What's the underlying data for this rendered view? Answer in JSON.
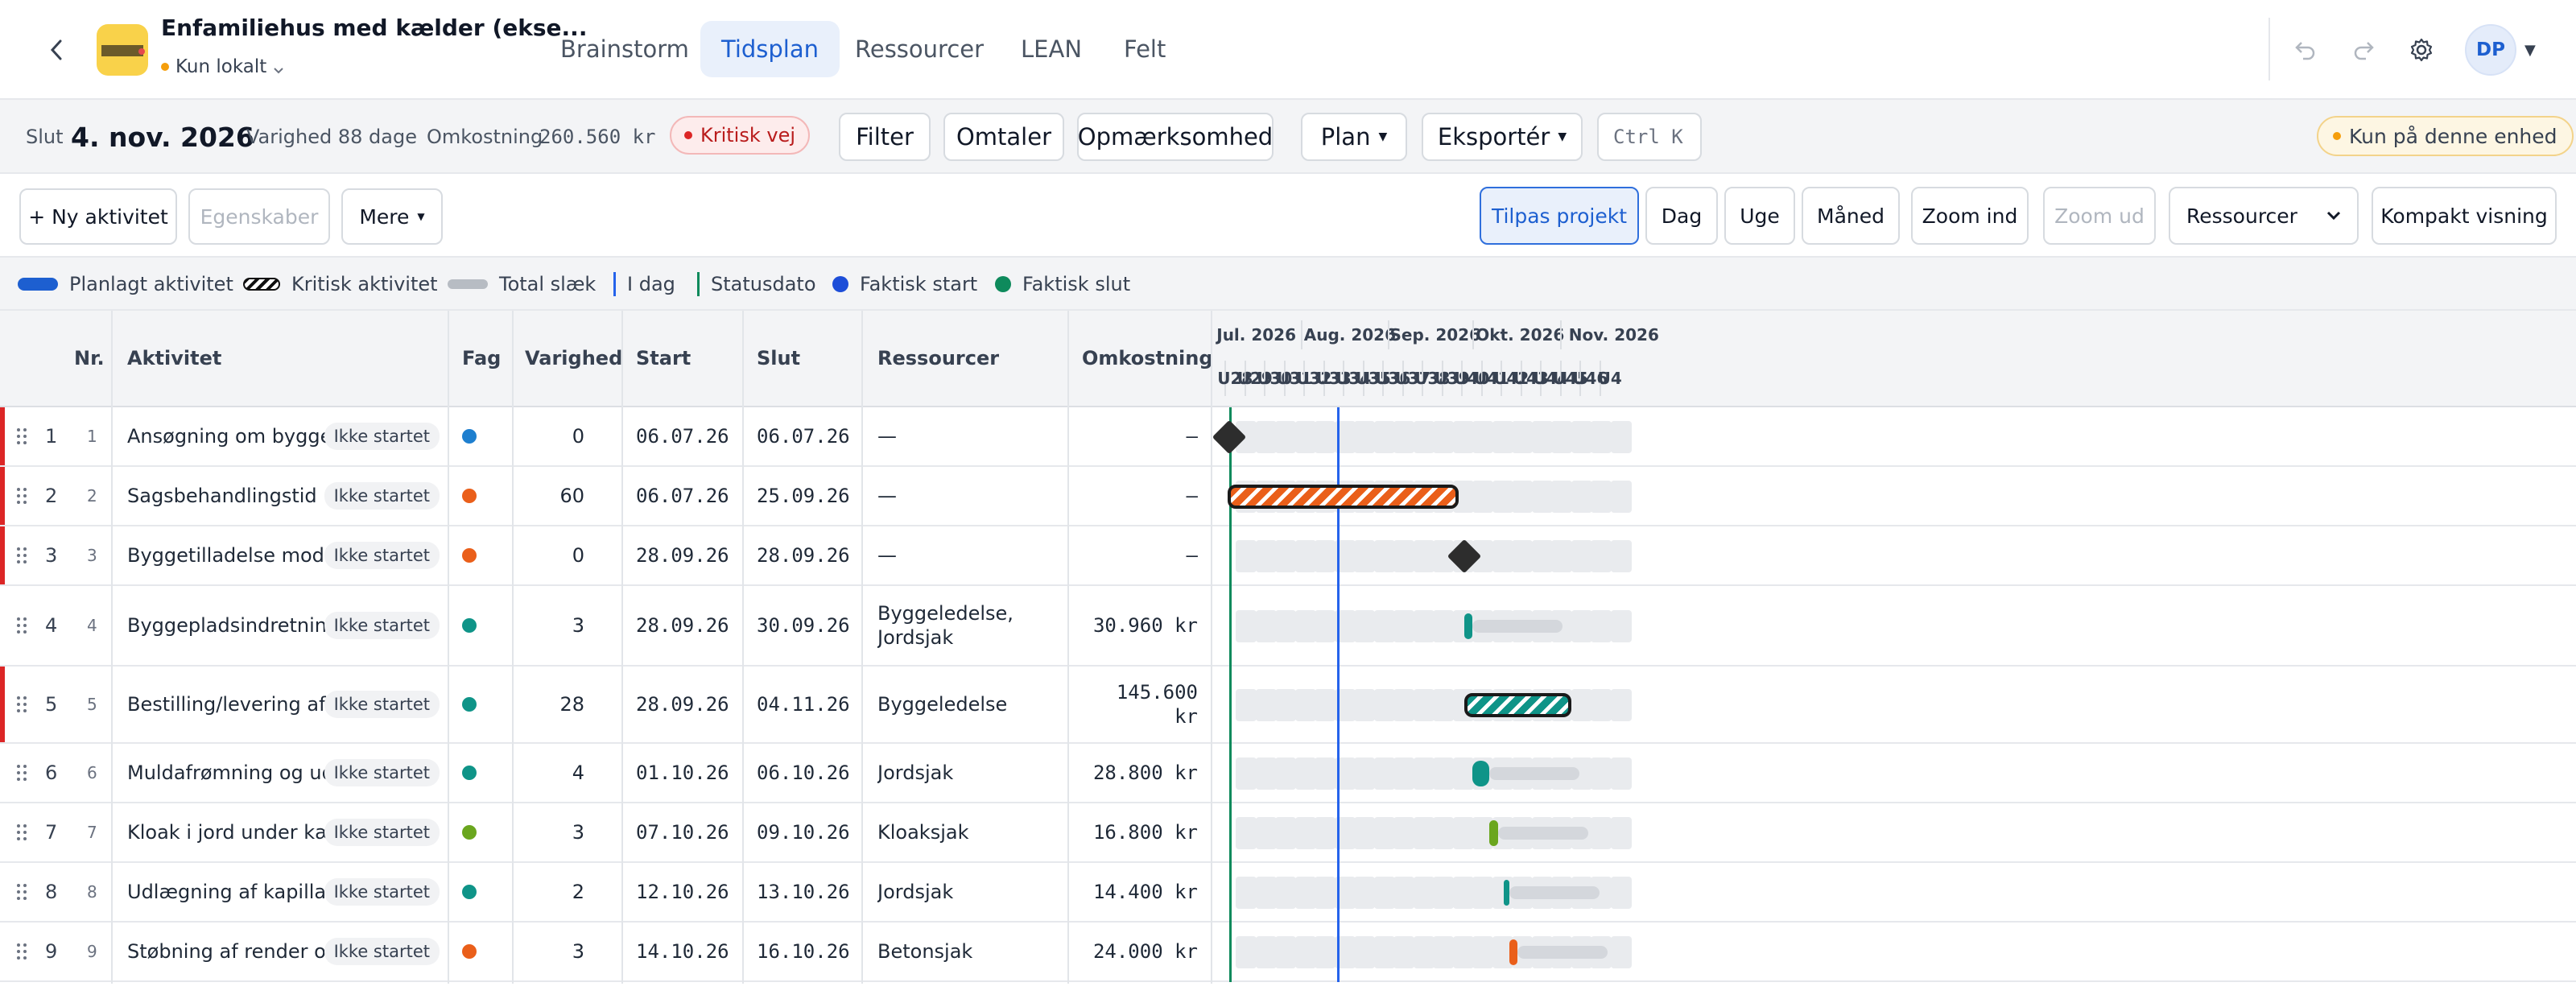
{
  "project": {
    "title": "Enfamiliehus med kælder (ekse...",
    "storage": "Kun lokalt"
  },
  "nav": {
    "tabs": [
      "Brainstorm",
      "Tidsplan",
      "Ressourcer",
      "LEAN",
      "Felt"
    ],
    "active": "Tidsplan"
  },
  "user": {
    "initials": "DP"
  },
  "summary": {
    "slut_label": "Slut",
    "slut_value": "4. nov. 2026",
    "varighed": "Varighed 88 dage",
    "omkostning_label": "Omkostning",
    "omkostning_value": "260.560 kr",
    "critical": "Kritisk vej",
    "device_only": "Kun på denne enhed"
  },
  "toolbar": {
    "filter": "Filter",
    "omtaler": "Omtaler",
    "opmaerksomhed": "Opmærksomhed",
    "plan": "Plan",
    "eksporter": "Eksportér",
    "shortcut": "Ctrl K"
  },
  "actions": {
    "new_activity": "+ Ny aktivitet",
    "properties": "Egenskaber",
    "more": "Mere"
  },
  "view": {
    "fit": "Tilpas projekt",
    "day": "Dag",
    "week": "Uge",
    "month": "Måned",
    "zoom_in": "Zoom ind",
    "zoom_out": "Zoom ud",
    "resource_select": "Ressourcer",
    "compact": "Kompakt visning"
  },
  "legend": {
    "planned": "Planlagt aktivitet",
    "critical": "Kritisk aktivitet",
    "slack": "Total slæk",
    "today": "I dag",
    "status": "Statusdato",
    "actual_start": "Faktisk start",
    "actual_end": "Faktisk slut"
  },
  "columns": {
    "nr": "Nr.",
    "activity": "Aktivitet",
    "fag": "Fag",
    "duration": "Varighed",
    "start": "Start",
    "end": "Slut",
    "resources": "Ressourcer",
    "cost": "Omkostning"
  },
  "timeline": {
    "months": [
      "Jul. 2026",
      "Aug. 2026",
      "Sep. 2026",
      "Okt. 2026",
      "Nov. 2026"
    ],
    "weeks": [
      "U28",
      "U29",
      "U30",
      "U31",
      "U32",
      "U33",
      "U34",
      "U35",
      "U36",
      "U37",
      "U38",
      "U39",
      "U40",
      "U41",
      "U42",
      "U43",
      "U44",
      "U45",
      "U46",
      "U4"
    ]
  },
  "status_label": "Ikke startet",
  "colors": {
    "primary": "#1d5fd0",
    "critical": "#dc2626",
    "orange": "#ea5f1a",
    "teal": "#0f9488",
    "green": "#6aa61e",
    "blue_fag": "#1e7fcf",
    "today": "#2563eb",
    "statusdate": "#0e8a5c"
  },
  "rows": [
    {
      "n": "1",
      "id": "1",
      "name": "Ansøgning om byggetilladelse",
      "status": "Ikke startet",
      "fag_color": "#1e7fcf",
      "dur": "0",
      "start": "06.07.26",
      "end": "06.07.26",
      "res": [
        "—"
      ],
      "cost": [
        "–"
      ],
      "critical": true
    },
    {
      "n": "2",
      "id": "2",
      "name": "Sagsbehandlingstid",
      "status": "Ikke startet",
      "fag_color": "#ea5f1a",
      "dur": "60",
      "start": "06.07.26",
      "end": "25.09.26",
      "res": [
        "—"
      ],
      "cost": [
        "–"
      ],
      "critical": true
    },
    {
      "n": "3",
      "id": "3",
      "name": "Byggetilladelse modtaget",
      "status": "Ikke startet",
      "fag_color": "#ea5f1a",
      "dur": "0",
      "start": "28.09.26",
      "end": "28.09.26",
      "res": [
        "—"
      ],
      "cost": [
        "–"
      ],
      "critical": true
    },
    {
      "n": "4",
      "id": "4",
      "name": "Byggepladsindretning",
      "status": "Ikke startet",
      "fag_color": "#0f9488",
      "dur": "3",
      "start": "28.09.26",
      "end": "30.09.26",
      "res": [
        "Byggeledelse,",
        "Jordsjak"
      ],
      "cost": [
        "30.960 kr"
      ],
      "critical": false
    },
    {
      "n": "5",
      "id": "5",
      "name": "Bestilling/levering af vinduer",
      "status": "Ikke startet",
      "fag_color": "#0f9488",
      "dur": "28",
      "start": "28.09.26",
      "end": "04.11.26",
      "res": [
        "Byggeledelse"
      ],
      "cost": [
        "145.600",
        "kr"
      ],
      "critical": true
    },
    {
      "n": "6",
      "id": "6",
      "name": "Muldafrømning og udgravning",
      "status": "Ikke startet",
      "fag_color": "#0f9488",
      "dur": "4",
      "start": "01.10.26",
      "end": "06.10.26",
      "res": [
        "Jordsjak"
      ],
      "cost": [
        "28.800 kr"
      ],
      "critical": false
    },
    {
      "n": "7",
      "id": "7",
      "name": "Kloak i jord under kælder",
      "status": "Ikke startet",
      "fag_color": "#6aa61e",
      "dur": "3",
      "start": "07.10.26",
      "end": "09.10.26",
      "res": [
        "Kloaksjak"
      ],
      "cost": [
        "16.800 kr"
      ],
      "critical": false
    },
    {
      "n": "8",
      "id": "8",
      "name": "Udlægning af kapillarbrydende lag",
      "status": "Ikke startet",
      "fag_color": "#0f9488",
      "dur": "2",
      "start": "12.10.26",
      "end": "13.10.26",
      "res": [
        "Jordsjak"
      ],
      "cost": [
        "14.400 kr"
      ],
      "critical": false
    },
    {
      "n": "9",
      "id": "9",
      "name": "Støbning af render og fundament",
      "status": "Ikke startet",
      "fag_color": "#ea5f1a",
      "dur": "3",
      "start": "14.10.26",
      "end": "16.10.26",
      "res": [
        "Betonsjak"
      ],
      "cost": [
        "24.000 kr"
      ],
      "critical": false
    }
  ]
}
